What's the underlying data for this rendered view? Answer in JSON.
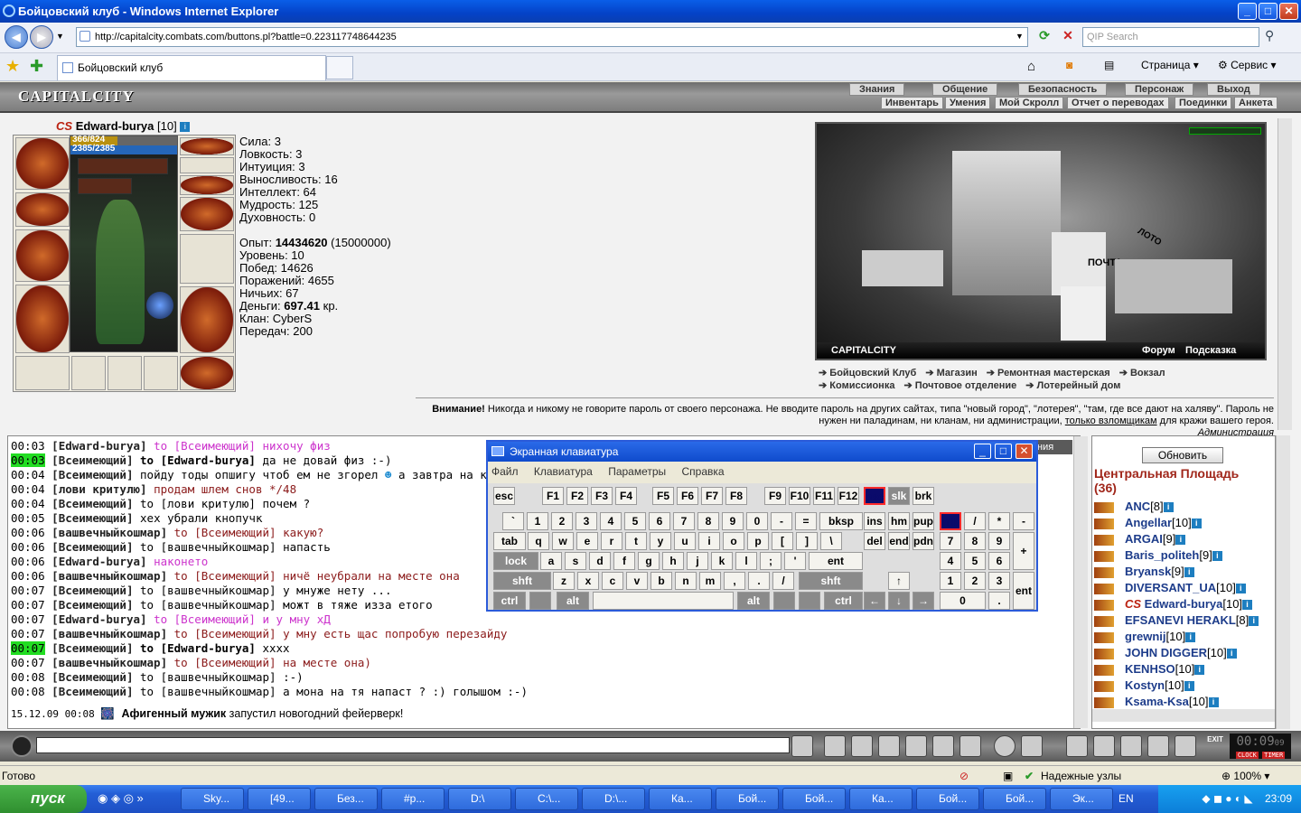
{
  "window": {
    "title": "Бойцовский клуб - Windows Internet Explorer",
    "minimize": "_",
    "maximize": "□",
    "close": "✕"
  },
  "browser": {
    "url": "http://capitalcity.combats.com/buttons.pl?battle=0.223117748644235",
    "search_placeholder": "QIP Search",
    "tab_title": "Бойцовский клуб",
    "page_label": "Страница",
    "service_label": "Сервис"
  },
  "game": {
    "logo": "CAPITALCITY",
    "menu_top": [
      "Знания",
      "Общение",
      "Безопасность",
      "Персонаж",
      "Выход"
    ],
    "menu_bottom": [
      "Инвентарь",
      "Умения",
      "Мой Скролл",
      "Отчет о переводах",
      "Поединки",
      "Анкета"
    ],
    "player": {
      "clan_tag": "CS",
      "name": "Edward-burya",
      "level": "[10]",
      "hp": "366/824",
      "mana": "2385/2385"
    },
    "stats": [
      "Сила: 3",
      "Ловкость: 3",
      "Интуиция: 3",
      "Выносливость: 16",
      "Интеллект: 64",
      "Мудрость: 125",
      "Духовность: 0"
    ],
    "exp_label": "Опыт:",
    "exp_value": "14434620",
    "exp_next": "(15000000)",
    "info": [
      "Уровень: 10",
      "Побед: 14626",
      "Поражений: 4655",
      "Ничьих: 67"
    ],
    "money_label": "Деньги:",
    "money_value": "697.41",
    "money_unit": "кр.",
    "clan": "Клан: CyberS",
    "transfers": "Передач: 200",
    "city_label": "CAPITALCITY",
    "city_links": [
      "Форум",
      "Подсказка"
    ],
    "locations_row1": [
      "Бойцовский Клуб",
      "Магазин",
      "Ремонтная мастерская",
      "Вокзал"
    ],
    "locations_row2": [
      "Комиссионка",
      "Почтовое отделение",
      "Лотерейный дом"
    ],
    "city_signs": [
      "ПОЧТА",
      "ЛОТО"
    ],
    "warning_bold": "Внимание!",
    "warning_text": "Никогда и никому не говорите пароль от своего персонажа. Не вводите пароль на других сайтах, типа \"новый город\", \"лотерея\", \"там, где все дают на халяву\". Пароль не нужен ни паладинам, ни кланам, ни администрации,",
    "warning_link": "только взломщикам",
    "warning_end": "для кражи вашего героя.",
    "warning_sign": "Администрация",
    "chat_tab": "ния"
  },
  "chat": [
    {
      "t": "00:03",
      "from": "[Edward-burya]",
      "to": "to [Всеимеющий]",
      "msg": "нихочу физ",
      "color": "pink"
    },
    {
      "t": "00:03",
      "hl": true,
      "from": "[Всеимеющий]",
      "to": "to [Edward-burya]",
      "msg": "да не довай физ :-)",
      "bold_to": true
    },
    {
      "t": "00:04",
      "from": "[Всеимеющий]",
      "to": "",
      "msg": "пойду тоды опшигу чтоб ем не згорел",
      "msg2": "а завтра на к"
    },
    {
      "t": "00:04",
      "from": "[лови критулю]",
      "to": "",
      "msg": "продам шлем снов */48",
      "color": "dred"
    },
    {
      "t": "00:04",
      "from": "[Всеимеющий]",
      "to": "to [лови критулю]",
      "msg": "почем ?"
    },
    {
      "t": "00:05",
      "from": "[Всеимеющий]",
      "to": "",
      "msg": "хех убрали кнопучк"
    },
    {
      "t": "00:06",
      "from": "[вашвечныйкошмар]",
      "to": "to [Всеимеющий]",
      "msg": "какую?",
      "color": "dred"
    },
    {
      "t": "00:06",
      "from": "[Всеимеющий]",
      "to": "to [вашвечныйкошмар]",
      "msg": "напасть"
    },
    {
      "t": "00:06",
      "from": "[Edward-burya]",
      "to": "",
      "msg": "наконето",
      "color": "pink"
    },
    {
      "t": "00:06",
      "from": "[вашвечныйкошмар]",
      "to": "to [Всеимеющий]",
      "msg": "ничё неубрали на месте она",
      "color": "dred"
    },
    {
      "t": "00:07",
      "from": "[Всеимеющий]",
      "to": "to [вашвечныйкошмар]",
      "msg": "у мнуже нету ..."
    },
    {
      "t": "00:07",
      "from": "[Всеимеющий]",
      "to": "to [вашвечныйкошмар]",
      "msg": "можт в тяже изза етого"
    },
    {
      "t": "00:07",
      "from": "[Edward-burya]",
      "to": "to [Всеимеющий]",
      "msg": "и у мну хД",
      "color": "pink"
    },
    {
      "t": "00:07",
      "from": "[вашвечныйкошмар]",
      "to": "to [Всеимеющий]",
      "msg": "у мну есть щас попробую перезайду",
      "color": "dred"
    },
    {
      "t": "00:07",
      "hl": true,
      "from": "[Всеимеющий]",
      "to": "to [Edward-burya]",
      "msg": "xxxx",
      "bold_to": true
    },
    {
      "t": "00:07",
      "from": "[вашвечныйкошмар]",
      "to": "to [Всеимеющий]",
      "msg": "на месте она)",
      "color": "dred"
    },
    {
      "t": "00:08",
      "from": "[Всеимеющий]",
      "to": "to [вашвечныйкошмар]",
      "msg": ":-)"
    },
    {
      "t": "00:08",
      "from": "[Всеимеющий]",
      "to": "to [вашвечныйкошмар]",
      "msg": "а мона на тя напаст ? :) голышом :-)"
    }
  ],
  "chat_system": {
    "date": "15.12.09 00:08",
    "who": "Афигенный мужик",
    "msg": "запустил новогодний фейерверк!"
  },
  "people": {
    "refresh": "Обновить",
    "location": "Центральная Площадь",
    "count": "(36)",
    "list": [
      {
        "name": "ANC",
        "lvl": "[8]"
      },
      {
        "name": "Angellar",
        "lvl": "[10]"
      },
      {
        "name": "ARGAI",
        "lvl": "[9]"
      },
      {
        "name": "Baris_politeh",
        "lvl": "[9]"
      },
      {
        "name": "Bryansk",
        "lvl": "[9]"
      },
      {
        "name": "DIVERSANT_UA",
        "lvl": "[10]"
      },
      {
        "name": "Edward-burya",
        "lvl": "[10]",
        "tag": "CS"
      },
      {
        "name": "EFSANEVI HERAKL",
        "lvl": "[8]"
      },
      {
        "name": "grewnij",
        "lvl": "[10]"
      },
      {
        "name": "JOHN DIGGER",
        "lvl": "[10]"
      },
      {
        "name": "KENHSO",
        "lvl": "[10]"
      },
      {
        "name": "Kostyn",
        "lvl": "[10]"
      },
      {
        "name": "Ksama-Ksa",
        "lvl": "[10]"
      }
    ]
  },
  "clock": {
    "time": "00:09",
    "sec": "09",
    "label1": "CLOCK",
    "label2": "TIMER",
    "exit": "EXIT"
  },
  "osk": {
    "title": "Экранная клавиатура",
    "menu": [
      "Файл",
      "Клавиатура",
      "Параметры",
      "Справка"
    ],
    "row0": [
      "esc",
      "F1",
      "F2",
      "F3",
      "F4",
      "F5",
      "F6",
      "F7",
      "F8",
      "F9",
      "F10",
      "F11",
      "F12",
      "psc",
      "slk",
      "brk"
    ],
    "row1": [
      "`",
      "1",
      "2",
      "3",
      "4",
      "5",
      "6",
      "7",
      "8",
      "9",
      "0",
      "-",
      "=",
      "bksp",
      "ins",
      "hm",
      "pup",
      "nlk",
      "/",
      "*",
      "-"
    ],
    "row2": [
      "tab",
      "q",
      "w",
      "e",
      "r",
      "t",
      "y",
      "u",
      "i",
      "o",
      "p",
      "[",
      "]",
      "\\",
      "del",
      "end",
      "pdn",
      "7",
      "8",
      "9",
      "+"
    ],
    "row3": [
      "lock",
      "a",
      "s",
      "d",
      "f",
      "g",
      "h",
      "j",
      "k",
      "l",
      ";",
      "'",
      "ent",
      "4",
      "5",
      "6"
    ],
    "row4": [
      "shft",
      "z",
      "x",
      "c",
      "v",
      "b",
      "n",
      "m",
      ",",
      ".",
      "/",
      "shft",
      "↑",
      "1",
      "2",
      "3",
      "ent"
    ],
    "row5": [
      "ctrl",
      "",
      "alt",
      "",
      "alt",
      "",
      "",
      "ctrl",
      "←",
      "↓",
      "→",
      "0",
      "."
    ]
  },
  "statusbar": {
    "status": "Готово",
    "zone": "Надежные узлы",
    "zoom": "100%"
  },
  "taskbar": {
    "start": "пуск",
    "tasks": [
      "Sky...",
      "[49...",
      "Без...",
      "#р...",
      "D:\\",
      "C:\\...",
      "D:\\...",
      "Ка...",
      "Бой...",
      "Бой...",
      "Ка...",
      "Бой...",
      "Бой...",
      "Эк..."
    ],
    "lang": "EN",
    "time": "23:09"
  }
}
